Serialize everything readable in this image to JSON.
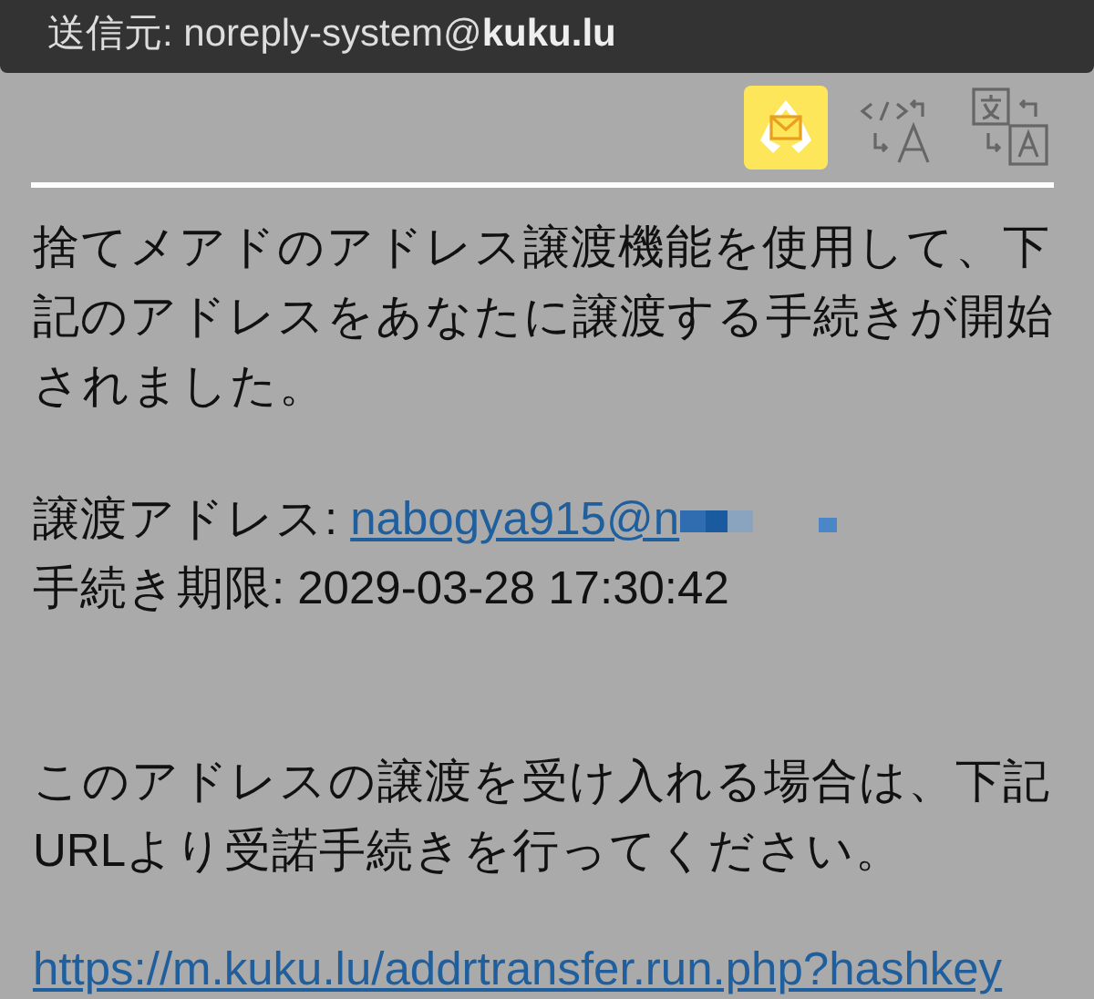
{
  "header": {
    "sender": "送信元: noreply-system@**kuku.lu**"
  },
  "body": {
    "intro": "捨てメアドのアドレス譲渡機能を使用して、下記のアドレスをあなたに譲渡する手続きが開始されました。",
    "fields": [
      {
        "kind": "link",
        "label": "譲渡アドレス:",
        "value": "nabogya915@n"
      },
      {
        "kind": "text",
        "label": "手続き期限:",
        "value": "2029-03-28 17:30:42"
      }
    ],
    "instruction": "このアドレスの譲渡を受け入れる場合は、下記URLより受諾手続きを行ってください。",
    "url": "https://m.kuku.lu/addrtransfer.run.php?hashkey"
  }
}
